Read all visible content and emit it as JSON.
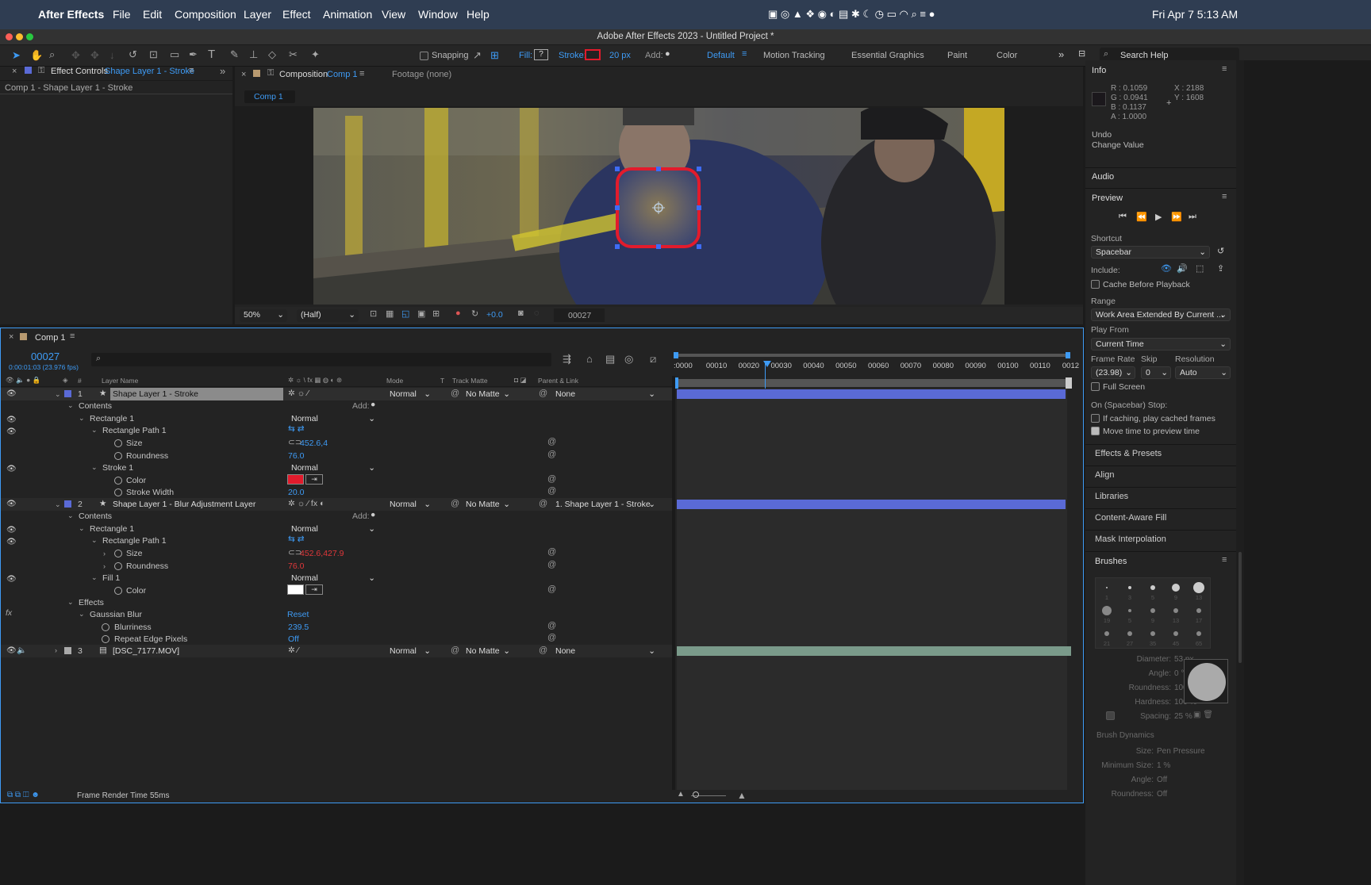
{
  "menubar": {
    "app": "After Effects",
    "items": [
      "File",
      "Edit",
      "Composition",
      "Layer",
      "Effect",
      "Animation",
      "View",
      "Window",
      "Help"
    ],
    "datetime": "Fri Apr 7  5:13 AM"
  },
  "window_title": "Adobe After Effects 2023 - Untitled Project *",
  "toolbar": {
    "snapping": "Snapping",
    "fill": "Fill:",
    "stroke": "Stroke:",
    "stroke_width": "20 px",
    "add": "Add:",
    "workspaces": [
      "Default",
      "Motion Tracking",
      "Essential Graphics",
      "Paint",
      "Color"
    ],
    "search": "Search Help"
  },
  "effect_controls": {
    "tab_prefix": "Effect Controls",
    "tab_layer": "Shape Layer 1 - Stroke",
    "breadcrumb": "Comp 1 - Shape Layer 1 - Stroke"
  },
  "composition": {
    "tab_prefix": "Composition",
    "tab_comp": "Comp 1",
    "footage_tab": "Footage (none)",
    "comp_tab": "Comp 1",
    "zoom": "50%",
    "resolution": "(Half)",
    "exposure": "+0.0",
    "timecode": "00027"
  },
  "timeline": {
    "tab": "Comp 1",
    "timecode": "00027",
    "timecode_sub": "0:00:01:03 (23.976 fps)",
    "col_layer_name": "Layer Name",
    "col_mode": "Mode",
    "col_t": "T",
    "col_track_matte": "Track Matte",
    "col_parent": "Parent & Link",
    "ruler": [
      ":0000",
      "00010",
      "00020",
      "00030",
      "00040",
      "00050",
      "00060",
      "00070",
      "00080",
      "00090",
      "00100",
      "00110",
      "0012"
    ],
    "layers": [
      {
        "num": "1",
        "name": "Shape Layer 1 - Stroke",
        "mode": "Normal",
        "matte": "No Matte",
        "parent": "None"
      },
      {
        "num": "2",
        "name": "Shape Layer 1 - Blur Adjustment Layer",
        "mode": "Normal",
        "matte": "No Matte",
        "parent": "1. Shape Layer 1 - Stroke"
      },
      {
        "num": "3",
        "name": "[DSC_7177.MOV]",
        "mode": "Normal",
        "matte": "No Matte",
        "parent": "None"
      }
    ],
    "l1": {
      "contents": "Contents",
      "add": "Add:",
      "rect": "Rectangle 1",
      "rect_mode": "Normal",
      "path": "Rectangle Path 1",
      "size": "Size",
      "size_val": "452.6,4",
      "roundness": "Roundness",
      "roundness_val": "76.0",
      "stroke": "Stroke 1",
      "stroke_mode": "Normal",
      "color": "Color",
      "stroke_width": "Stroke Width",
      "stroke_width_val": "20.0"
    },
    "l2": {
      "contents": "Contents",
      "add": "Add:",
      "rect": "Rectangle 1",
      "rect_mode": "Normal",
      "path": "Rectangle Path 1",
      "size": "Size",
      "size_val": "452.6,427.9",
      "roundness": "Roundness",
      "roundness_val": "76.0",
      "fill": "Fill 1",
      "fill_mode": "Normal",
      "color": "Color",
      "effects": "Effects",
      "blur": "Gaussian Blur",
      "reset": "Reset",
      "blurriness": "Blurriness",
      "blurriness_val": "239.5",
      "repeat": "Repeat Edge Pixels",
      "repeat_val": "Off"
    },
    "footer": "Frame Render Time",
    "footer_val": "55ms"
  },
  "info": {
    "title": "Info",
    "r": "R : 0.1059",
    "g": "G : 0.0941",
    "b": "B : 0.1137",
    "a": "A : 1.0000",
    "x": "X : 2188",
    "y": "Y : 1608",
    "undo": "Undo",
    "undo_action": "Change Value"
  },
  "right": {
    "audio": "Audio",
    "preview": "Preview",
    "shortcut": "Shortcut",
    "shortcut_val": "Spacebar",
    "include": "Include:",
    "cache": "Cache Before Playback",
    "range": "Range",
    "range_val": "Work Area Extended By Current ...",
    "play_from": "Play From",
    "play_from_val": "Current Time",
    "frame_rate": "Frame Rate",
    "skip": "Skip",
    "resolution": "Resolution",
    "fr_val": "(23.98)",
    "skip_val": "0",
    "res_val": "Auto",
    "full_screen": "Full Screen",
    "on_stop": "On (Spacebar) Stop:",
    "if_caching": "If caching, play cached frames",
    "move_time": "Move time to preview time",
    "panels": [
      "Effects & Presets",
      "Align",
      "Libraries",
      "Content-Aware Fill",
      "Mask Interpolation"
    ],
    "brushes": "Brushes",
    "brush_sizes": [
      "1",
      "3",
      "5",
      "9",
      "13",
      "19",
      "5",
      "9",
      "13",
      "17",
      "21",
      "27",
      "35",
      "45",
      "65"
    ],
    "diameter": "Diameter:",
    "diameter_val": "53 px",
    "angle": "Angle:",
    "angle_val": "0 °",
    "roundness": "Roundness:",
    "roundness_val": "100 %",
    "hardness": "Hardness:",
    "hardness_val": "100 %",
    "spacing": "Spacing:",
    "spacing_val": "25 %",
    "dynamics": "Brush Dynamics",
    "dyn_size": "Size:",
    "dyn_size_val": "Pen Pressure",
    "dyn_min": "Minimum Size:",
    "dyn_min_val": "1 %",
    "dyn_angle": "Angle:",
    "dyn_angle_val": "Off",
    "dyn_round": "Roundness:",
    "dyn_round_val": "Off"
  },
  "colors": {
    "accent": "#3e9bf5",
    "stroke_red": "#e21b2c",
    "layer_bar": "#5a6ad6",
    "footage_bar": "#7a9a8a"
  }
}
